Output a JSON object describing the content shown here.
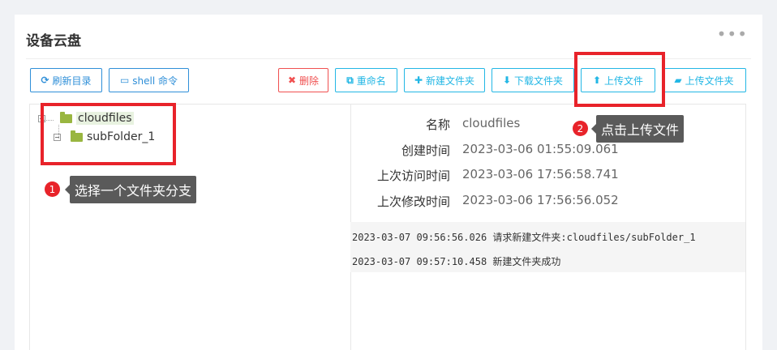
{
  "header": {
    "title": "设备云盘",
    "more_icon": "ellipsis-icon"
  },
  "toolbar": {
    "refresh": "刷新目录",
    "shell": "shell 命令",
    "delete": "删除",
    "rename": "重命名",
    "new_folder": "新建文件夹",
    "download_folder": "下载文件夹",
    "upload_file": "上传文件",
    "upload_folder": "上传文件夹"
  },
  "tree": {
    "root": "cloudfiles",
    "child": "subFolder_1"
  },
  "details": {
    "name_label": "名称",
    "name_value": "cloudfiles",
    "created_label": "创建时间",
    "created_value": "2023-03-06 01:55:09.061",
    "accessed_label": "上次访问时间",
    "accessed_value": "2023-03-06 17:56:58.741",
    "modified_label": "上次修改时间",
    "modified_value": "2023-03-06 17:56:56.052"
  },
  "log": [
    "2023-03-07 09:56:56.026 请求新建文件夹:cloudfiles/subFolder_1",
    "2023-03-07 09:57:10.458 新建文件夹成功"
  ],
  "annotations": {
    "step1_num": "1",
    "step1_text": "选择一个文件夹分支",
    "step2_num": "2",
    "step2_text": "点击上传文件"
  },
  "colors": {
    "accent": "#23b7e5",
    "danger": "#f05050",
    "folder": "#99b640",
    "highlight": "#e8232a"
  }
}
